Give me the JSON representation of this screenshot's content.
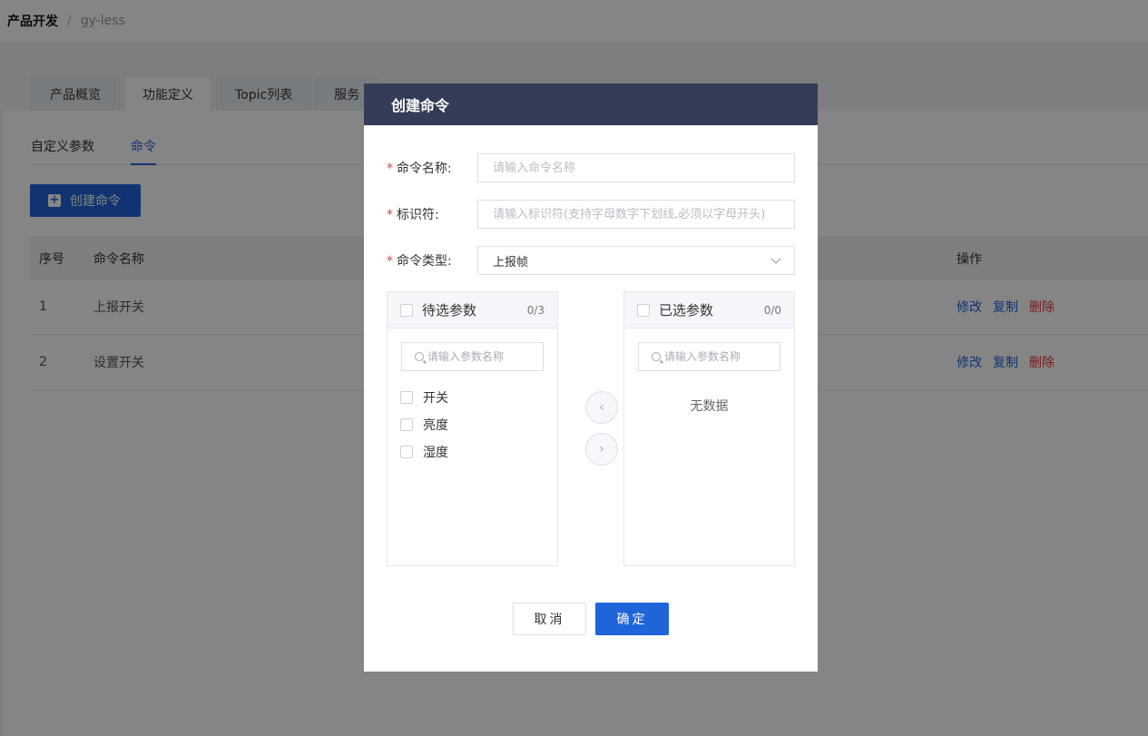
{
  "breadcrumb": {
    "root": "产品开发",
    "separator": "/",
    "current": "gy-less"
  },
  "tabs": [
    {
      "label": "产品概览"
    },
    {
      "label": "功能定义"
    },
    {
      "label": "Topic列表"
    },
    {
      "label": "服务"
    }
  ],
  "subtabs": [
    {
      "label": "自定义参数"
    },
    {
      "label": "命令"
    }
  ],
  "toolbar": {
    "create_label": "创建命令"
  },
  "table": {
    "headers": {
      "index": "序号",
      "name": "命令名称",
      "ops": "操作"
    },
    "rows": [
      {
        "index": "1",
        "name": "上报开关",
        "edit": "修改",
        "copy": "复制",
        "delete": "删除"
      },
      {
        "index": "2",
        "name": "设置开关",
        "edit": "修改",
        "copy": "复制",
        "delete": "删除"
      }
    ]
  },
  "modal": {
    "title": "创建命令",
    "required_mark": "*",
    "fields": {
      "name": {
        "label": "命令名称:",
        "placeholder": "请输入命令名称"
      },
      "identifier": {
        "label": "标识符:",
        "placeholder": "请输入标识符(支持字母数字下划线,必须以字母开头)"
      },
      "type": {
        "label": "命令类型:",
        "value": "上报帧"
      }
    },
    "transfer": {
      "left": {
        "title": "待选参数",
        "count": "0/3",
        "search_placeholder": "请输入参数名称",
        "items": [
          "开关",
          "亮度",
          "湿度"
        ]
      },
      "right": {
        "title": "已选参数",
        "count": "0/0",
        "search_placeholder": "请输入参数名称",
        "empty_text": "无数据"
      }
    },
    "cancel_label": "取消",
    "ok_label": "确定"
  },
  "colors": {
    "primary": "#1f64d8",
    "danger": "#e23b3b",
    "modal_header": "#333d57"
  }
}
